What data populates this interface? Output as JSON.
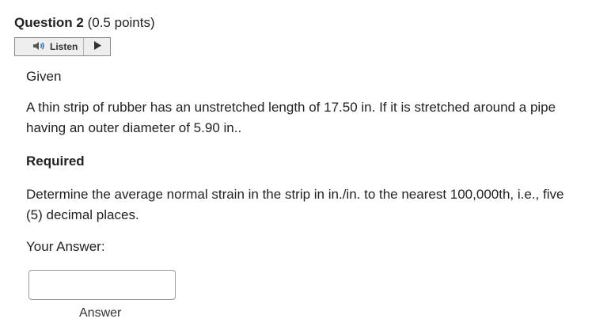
{
  "question": {
    "title": "Question 2",
    "points": "(0.5 points)"
  },
  "listen": {
    "label": "Listen",
    "speaker_icon": "speaker-icon",
    "play_icon": "play-icon"
  },
  "given": {
    "title": "Given",
    "text": "A thin strip of rubber has an unstretched length of 17.50 in. If it is stretched around a pipe having an outer diameter of 5.90 in.."
  },
  "required": {
    "title": "Required",
    "text": "Determine the average normal strain in the strip in in./in. to the nearest 100,000th, i.e., five (5) decimal places."
  },
  "answer": {
    "prompt": "Your Answer:",
    "value": "",
    "label": "Answer"
  },
  "colors": {
    "text": "#222222",
    "border": "#9a9a9a",
    "speaker": "#2f6fb0"
  }
}
